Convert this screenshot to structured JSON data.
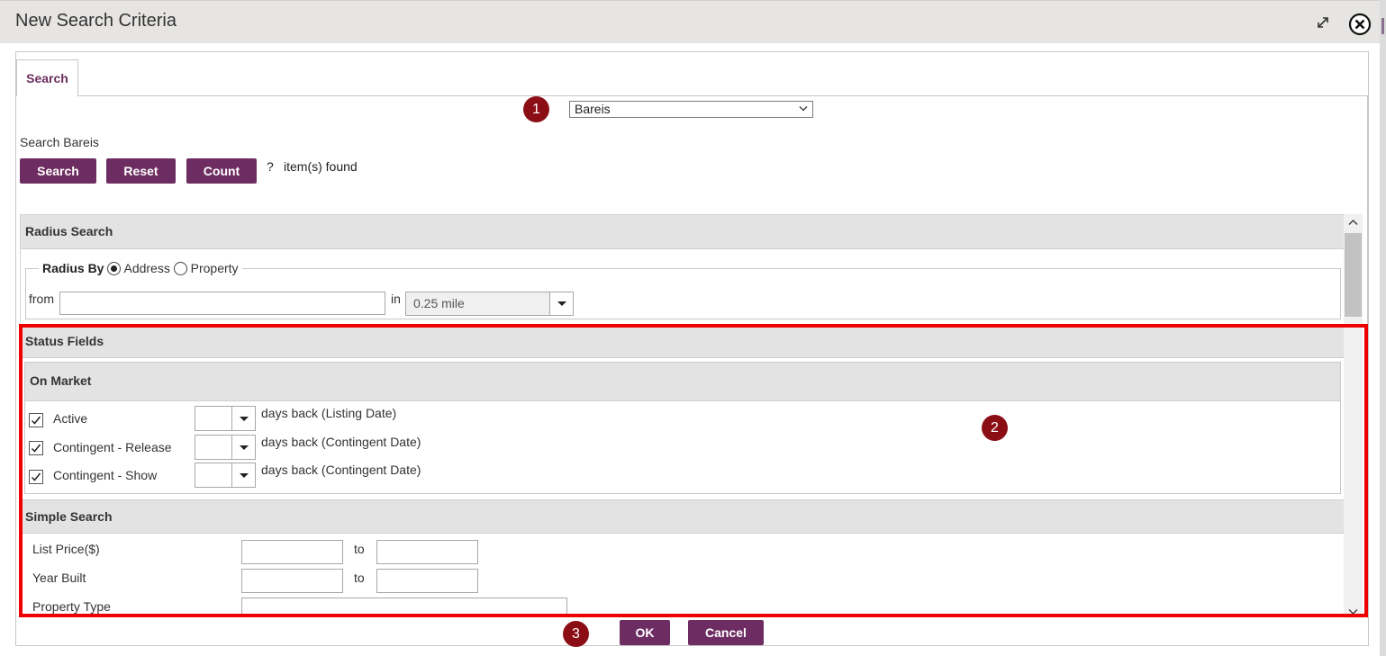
{
  "window": {
    "title": "New Search Criteria",
    "expand_icon": "expand-icon",
    "close_icon": "close-icon"
  },
  "tabs": [
    {
      "label": "Search",
      "active": true
    }
  ],
  "callouts": [
    "1",
    "2",
    "3"
  ],
  "source_select": {
    "value": "Bareis"
  },
  "search_section": {
    "label": "Search Bareis",
    "buttons": {
      "search": "Search",
      "reset": "Reset",
      "count": "Count"
    },
    "count_value": "?",
    "found_text": "item(s) found"
  },
  "radius_search": {
    "header": "Radius Search",
    "legend": "Radius By",
    "options": [
      {
        "label": "Address",
        "selected": true
      },
      {
        "label": "Property",
        "selected": false
      }
    ],
    "from_label": "from",
    "from_value": "",
    "in_label": "in",
    "distance": "0.25 mile"
  },
  "status_fields": {
    "header": "Status Fields",
    "on_market": {
      "header": "On Market",
      "rows": [
        {
          "label": "Active",
          "checked": true,
          "days": "",
          "suffix": "days back (Listing Date)"
        },
        {
          "label": "Contingent - Release",
          "checked": true,
          "days": "",
          "suffix": "days back (Contingent Date)"
        },
        {
          "label": "Contingent - Show",
          "checked": true,
          "days": "",
          "suffix": "days back (Contingent Date)"
        }
      ]
    }
  },
  "simple_search": {
    "header": "Simple Search",
    "to_label": "to",
    "fields": [
      {
        "label": "List Price($)",
        "from": "",
        "to": ""
      },
      {
        "label": "Year Built",
        "from": "",
        "to": ""
      },
      {
        "label": "Property Type",
        "value": ""
      }
    ]
  },
  "footer": {
    "ok": "OK",
    "cancel": "Cancel"
  },
  "colors": {
    "accent": "#6e2d62",
    "callout": "#8b0e15",
    "highlight": "#ee0000",
    "tab_text": "#6b2d5e"
  }
}
